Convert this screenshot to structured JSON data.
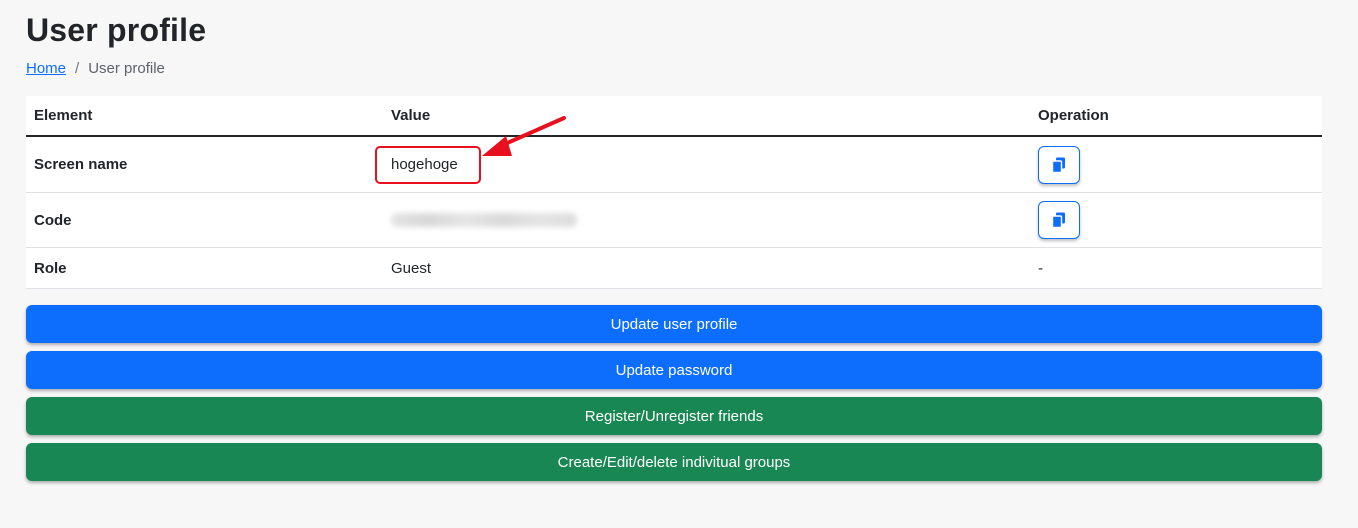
{
  "page": {
    "title": "User profile"
  },
  "breadcrumb": {
    "home_label": "Home",
    "separator": "/",
    "current_label": "User profile"
  },
  "table": {
    "headers": {
      "element": "Element",
      "value": "Value",
      "operation": "Operation"
    },
    "rows": [
      {
        "element": "Screen name",
        "value": "hogehoge",
        "operation": "copy-icon"
      },
      {
        "element": "Code",
        "value": "",
        "operation": "copy-icon"
      },
      {
        "element": "Role",
        "value": "Guest",
        "operation": "-"
      }
    ]
  },
  "buttons": {
    "update_profile": "Update user profile",
    "update_password": "Update password",
    "friends": "Register/Unregister friends",
    "groups": "Create/Edit/delete indivitual groups"
  },
  "colors": {
    "primary": "#0d6efd",
    "success": "#198754",
    "annotation_red": "#e8101e",
    "background": "#f7f7f8"
  }
}
